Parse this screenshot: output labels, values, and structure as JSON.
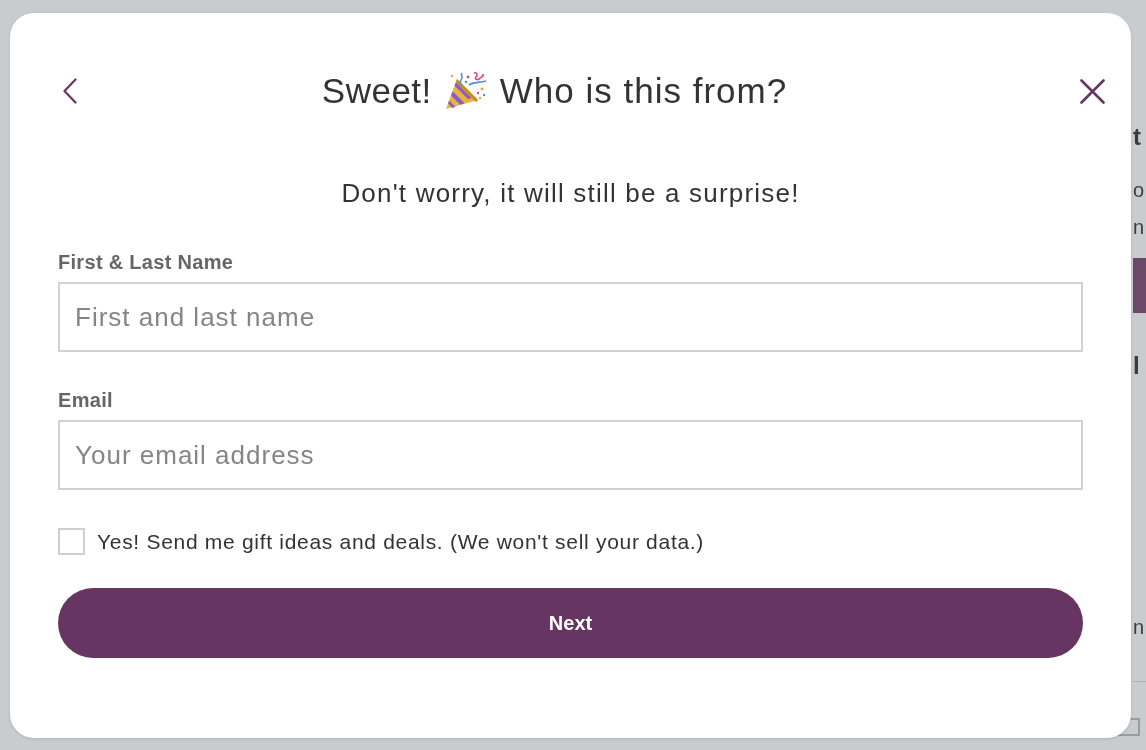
{
  "background_page": {
    "fragments": [
      {
        "kind": "heading",
        "text": "t"
      },
      {
        "kind": "text",
        "text": "o"
      },
      {
        "kind": "text",
        "text": "n"
      },
      {
        "kind": "bar"
      },
      {
        "kind": "heading",
        "text": "l"
      },
      {
        "kind": "text",
        "text": "n"
      },
      {
        "kind": "rule"
      },
      {
        "kind": "square"
      }
    ]
  },
  "dialog": {
    "title": {
      "lead": "Sweet!",
      "rest": "Who is this from?"
    },
    "subtitle": "Don't worry, it will still be a surprise!",
    "fields": [
      {
        "label": "First & Last Name",
        "placeholder": "First and last name"
      },
      {
        "label": "Email",
        "placeholder": "Your email address"
      }
    ],
    "opt_in": {
      "label": "Yes! Send me gift ideas and deals. (We won't sell your data.)",
      "checked": false
    },
    "next_button": {
      "label": "Next"
    }
  }
}
